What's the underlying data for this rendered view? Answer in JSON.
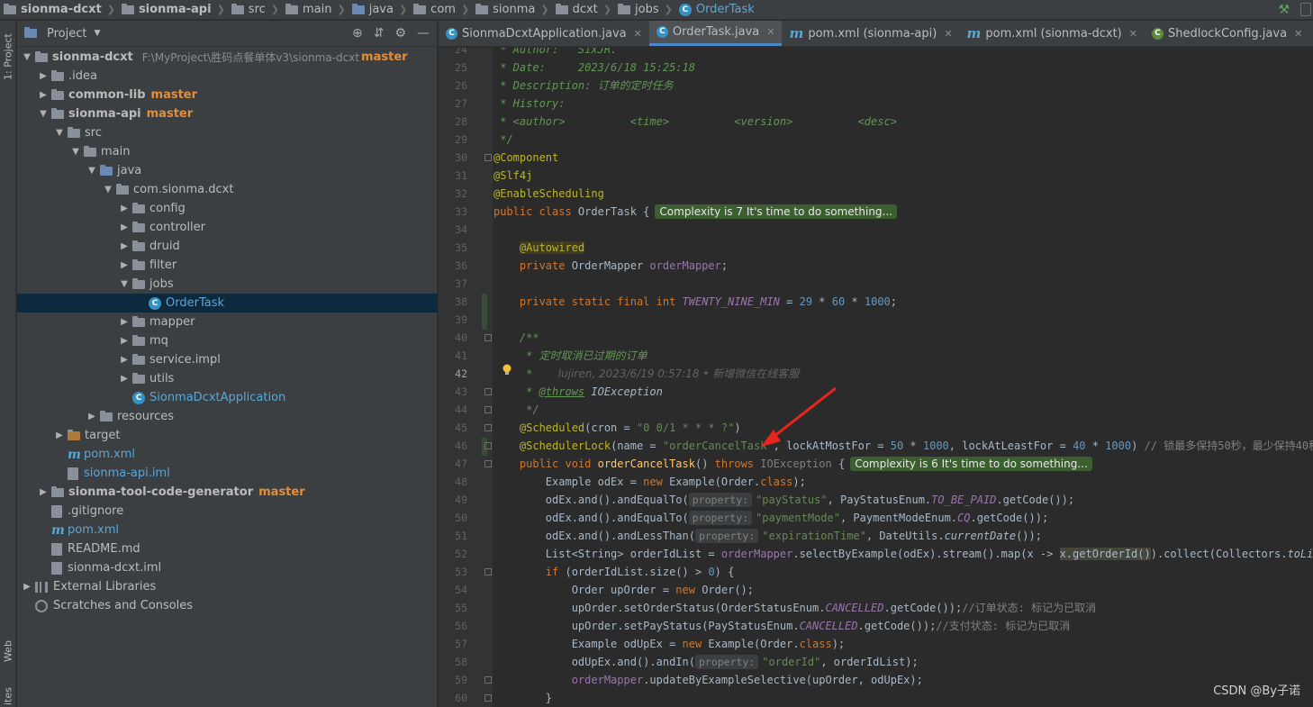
{
  "breadcrumbs": [
    {
      "label": "sionma-dcxt",
      "icon": "module-folder-icon",
      "bold": true
    },
    {
      "label": "sionma-api",
      "icon": "module-folder-icon",
      "bold": true
    },
    {
      "label": "src",
      "icon": "folder-icon"
    },
    {
      "label": "main",
      "icon": "folder-icon"
    },
    {
      "label": "java",
      "icon": "source-folder-icon"
    },
    {
      "label": "com",
      "icon": "package-icon"
    },
    {
      "label": "sionma",
      "icon": "package-icon"
    },
    {
      "label": "dcxt",
      "icon": "package-icon"
    },
    {
      "label": "jobs",
      "icon": "package-icon"
    },
    {
      "label": "OrderTask",
      "icon": "class-icon"
    }
  ],
  "stripe": {
    "project_tab": "1: Project",
    "web_tab": "Web",
    "bottom_tab": "ites"
  },
  "project_panel": {
    "title": "Project",
    "tree": [
      {
        "label": "sionma-dcxt",
        "path": "F:\\MyProject\\胜码点餐单体v3\\sionma-dcxt",
        "branch": "master",
        "bold": true,
        "depth": 0,
        "arrow": "▼",
        "icon": "folder"
      },
      {
        "label": ".idea",
        "depth": 1,
        "arrow": "▶",
        "icon": "folder"
      },
      {
        "label": "common-lib",
        "branch": "master",
        "bold": true,
        "depth": 1,
        "arrow": "▶",
        "icon": "folder"
      },
      {
        "label": "sionma-api",
        "branch": "master",
        "bold": true,
        "depth": 1,
        "arrow": "▼",
        "icon": "folder"
      },
      {
        "label": "src",
        "depth": 2,
        "arrow": "▼",
        "icon": "folder"
      },
      {
        "label": "main",
        "depth": 3,
        "arrow": "▼",
        "icon": "folder"
      },
      {
        "label": "java",
        "depth": 4,
        "arrow": "▼",
        "icon": "blue-folder"
      },
      {
        "label": "com.sionma.dcxt",
        "depth": 5,
        "arrow": "▼",
        "icon": "folder"
      },
      {
        "label": "config",
        "depth": 6,
        "arrow": "▶",
        "icon": "folder"
      },
      {
        "label": "controller",
        "depth": 6,
        "arrow": "▶",
        "icon": "folder"
      },
      {
        "label": "druid",
        "depth": 6,
        "arrow": "▶",
        "icon": "folder"
      },
      {
        "label": "filter",
        "depth": 6,
        "arrow": "▶",
        "icon": "folder"
      },
      {
        "label": "jobs",
        "depth": 6,
        "arrow": "▼",
        "icon": "folder"
      },
      {
        "label": "OrderTask",
        "depth": 7,
        "arrow": "",
        "icon": "class",
        "selected": true,
        "blue": true
      },
      {
        "label": "mapper",
        "depth": 6,
        "arrow": "▶",
        "icon": "folder"
      },
      {
        "label": "mq",
        "depth": 6,
        "arrow": "▶",
        "icon": "folder"
      },
      {
        "label": "service.impl",
        "depth": 6,
        "arrow": "▶",
        "icon": "folder"
      },
      {
        "label": "utils",
        "depth": 6,
        "arrow": "▶",
        "icon": "folder"
      },
      {
        "label": "SionmaDcxtApplication",
        "depth": 6,
        "arrow": "",
        "icon": "class",
        "blue": true
      },
      {
        "label": "resources",
        "depth": 4,
        "arrow": "▶",
        "icon": "folder"
      },
      {
        "label": "target",
        "depth": 2,
        "arrow": "▶",
        "icon": "orange-folder"
      },
      {
        "label": "pom.xml",
        "depth": 2,
        "arrow": "",
        "icon": "maven",
        "blue": true
      },
      {
        "label": "sionma-api.iml",
        "depth": 2,
        "arrow": "",
        "icon": "file",
        "blue": true
      },
      {
        "label": "sionma-tool-code-generator",
        "branch": "master",
        "bold": true,
        "depth": 1,
        "arrow": "▶",
        "icon": "folder"
      },
      {
        "label": ".gitignore",
        "depth": 1,
        "arrow": "",
        "icon": "file"
      },
      {
        "label": "pom.xml",
        "depth": 1,
        "arrow": "",
        "icon": "maven",
        "blue": true
      },
      {
        "label": "README.md",
        "depth": 1,
        "arrow": "",
        "icon": "file"
      },
      {
        "label": "sionma-dcxt.iml",
        "depth": 1,
        "arrow": "",
        "icon": "file"
      },
      {
        "label": "External Libraries",
        "depth": 0,
        "arrow": "▶",
        "icon": "library"
      },
      {
        "label": "Scratches and Consoles",
        "depth": 0,
        "arrow": "",
        "icon": "scratch"
      }
    ]
  },
  "tabs": [
    {
      "label": "SionmaDcxtApplication.java",
      "icon": "class-icon"
    },
    {
      "label": "OrderTask.java",
      "icon": "class-icon",
      "active": true
    },
    {
      "label": "pom.xml (sionma-api)",
      "icon": "maven-icon"
    },
    {
      "label": "pom.xml (sionma-dcxt)",
      "icon": "maven-icon"
    },
    {
      "label": "ShedlockConfig.java",
      "icon": "config-class-icon"
    }
  ],
  "editor": {
    "line_numbers": [
      "24",
      "25",
      "26",
      "27",
      "28",
      "29",
      "30",
      "31",
      "32",
      "33",
      "34",
      "35",
      "36",
      "37",
      "38",
      "39",
      "40",
      "41",
      "42",
      "43",
      "44",
      "45",
      "46",
      "47",
      "48",
      "49",
      "50",
      "51",
      "52",
      "53",
      "54",
      "55",
      "56",
      "57",
      "58",
      "59",
      "60"
    ],
    "current_line": "42",
    "complexity_7": "Complexity is 7 It's time to do something...",
    "complexity_6": "Complexity is 6 It's time to do something...",
    "blame_42": "lujiren, 2023/6/19 0:57:18 • 新增微信在线客服",
    "hint_property": "property:"
  },
  "watermark": "CSDN @By子诺",
  "colors": {
    "branch": "#e28e3b",
    "selection": "#0d293e",
    "keyword": "#cc7832",
    "annotation": "#bbb529",
    "string": "#6a8759",
    "number": "#6897bb",
    "arrow": "#e8251e"
  }
}
